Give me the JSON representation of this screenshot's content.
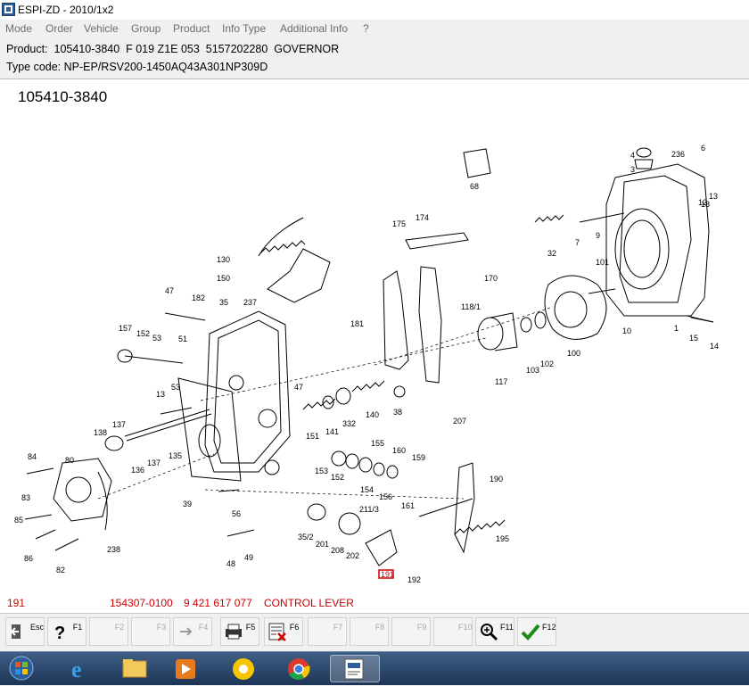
{
  "window": {
    "title": "ESPI-ZD - 2010/1x2"
  },
  "menu": [
    "Mode",
    "Order",
    "Vehicle",
    "Group",
    "Product",
    "Info Type",
    "Additional Info",
    "?"
  ],
  "product": {
    "line": "Product:  105410-3840  F 019 Z1E 053  5157202280  GOVERNOR",
    "type_code": "Type code: NP-EP/RSV200-1450AQ43A301NP309D"
  },
  "drawing": {
    "title": "105410-3840",
    "labels": {
      "l4": "4",
      "l3": "3",
      "l236": "236",
      "l6": "6",
      "l68": "68",
      "l175": "175",
      "l174": "174",
      "l18": "18",
      "l13": "13",
      "l12": "12",
      "l7": "7",
      "l9": "9",
      "l32": "32",
      "l130": "130",
      "l150": "150",
      "l170": "170",
      "l101": "101",
      "l47a": "47",
      "l182": "182",
      "l35": "35",
      "l237": "237",
      "l181": "181",
      "l1187": "118/1",
      "l157": "157",
      "l152": "152",
      "l53a": "53",
      "l51": "51",
      "l117": "117",
      "l103": "103",
      "l102": "102",
      "l100": "100",
      "l10": "10",
      "l1": "1",
      "l15": "15",
      "l14": "14",
      "l53b": "53",
      "l13b": "13",
      "l47b": "47",
      "l38": "38",
      "l332": "332",
      "l140": "140",
      "l207": "207",
      "l137a": "137",
      "l138": "138",
      "l135": "135",
      "l137b": "137",
      "l136": "136",
      "l151": "151",
      "l141": "141",
      "l155": "155",
      "l160": "160",
      "l159": "159",
      "l84": "84",
      "l80": "80",
      "l153": "153",
      "l152b": "152",
      "l154": "154",
      "l156": "156",
      "l161": "161",
      "l190": "190",
      "l83": "83",
      "l39": "39",
      "l56": "56",
      "l2118": "211/3",
      "l85": "85",
      "l86": "86",
      "l238": "238",
      "l352": "35/2",
      "l201": "201",
      "l208": "208",
      "l202": "202",
      "l195": "195",
      "l82": "82",
      "l48": "48",
      "l49": "49",
      "l191": "191",
      "l192": "192"
    }
  },
  "selection": {
    "pos": "191",
    "part_no": "154307-0100",
    "bosch_no": "9 421 617 077",
    "description": "CONTROL LEVER"
  },
  "fkeys": [
    {
      "id": "esc",
      "label": "Esc",
      "enabled": true,
      "icon": "exit-icon"
    },
    {
      "id": "f1",
      "label": "F1",
      "enabled": true,
      "icon": "help-icon"
    },
    {
      "id": "f2",
      "label": "F2",
      "enabled": false,
      "icon": ""
    },
    {
      "id": "f3",
      "label": "F3",
      "enabled": false,
      "icon": ""
    },
    {
      "id": "f4",
      "label": "F4",
      "enabled": false,
      "icon": "arrow-right-icon"
    },
    {
      "id": "f5",
      "label": "F5",
      "enabled": true,
      "icon": "printer-icon"
    },
    {
      "id": "f6",
      "label": "F6",
      "enabled": true,
      "icon": "list-delete-icon"
    },
    {
      "id": "f7",
      "label": "F7",
      "enabled": false,
      "icon": ""
    },
    {
      "id": "f8",
      "label": "F8",
      "enabled": false,
      "icon": ""
    },
    {
      "id": "f9",
      "label": "F9",
      "enabled": false,
      "icon": ""
    },
    {
      "id": "f10",
      "label": "F10",
      "enabled": false,
      "icon": ""
    },
    {
      "id": "f11",
      "label": "F11",
      "enabled": true,
      "icon": "zoom-icon"
    },
    {
      "id": "f12",
      "label": "F12",
      "enabled": true,
      "icon": "checkmark-icon"
    }
  ],
  "taskbar": [
    "start-orb-icon",
    "internet-explorer-icon",
    "file-explorer-icon",
    "media-player-icon",
    "chrome-alt-icon",
    "chrome-icon",
    "espi-app-icon"
  ],
  "colors": {
    "selection_text": "#c80000",
    "highlight_box": "#d00000",
    "taskbar": "#2a4466"
  }
}
